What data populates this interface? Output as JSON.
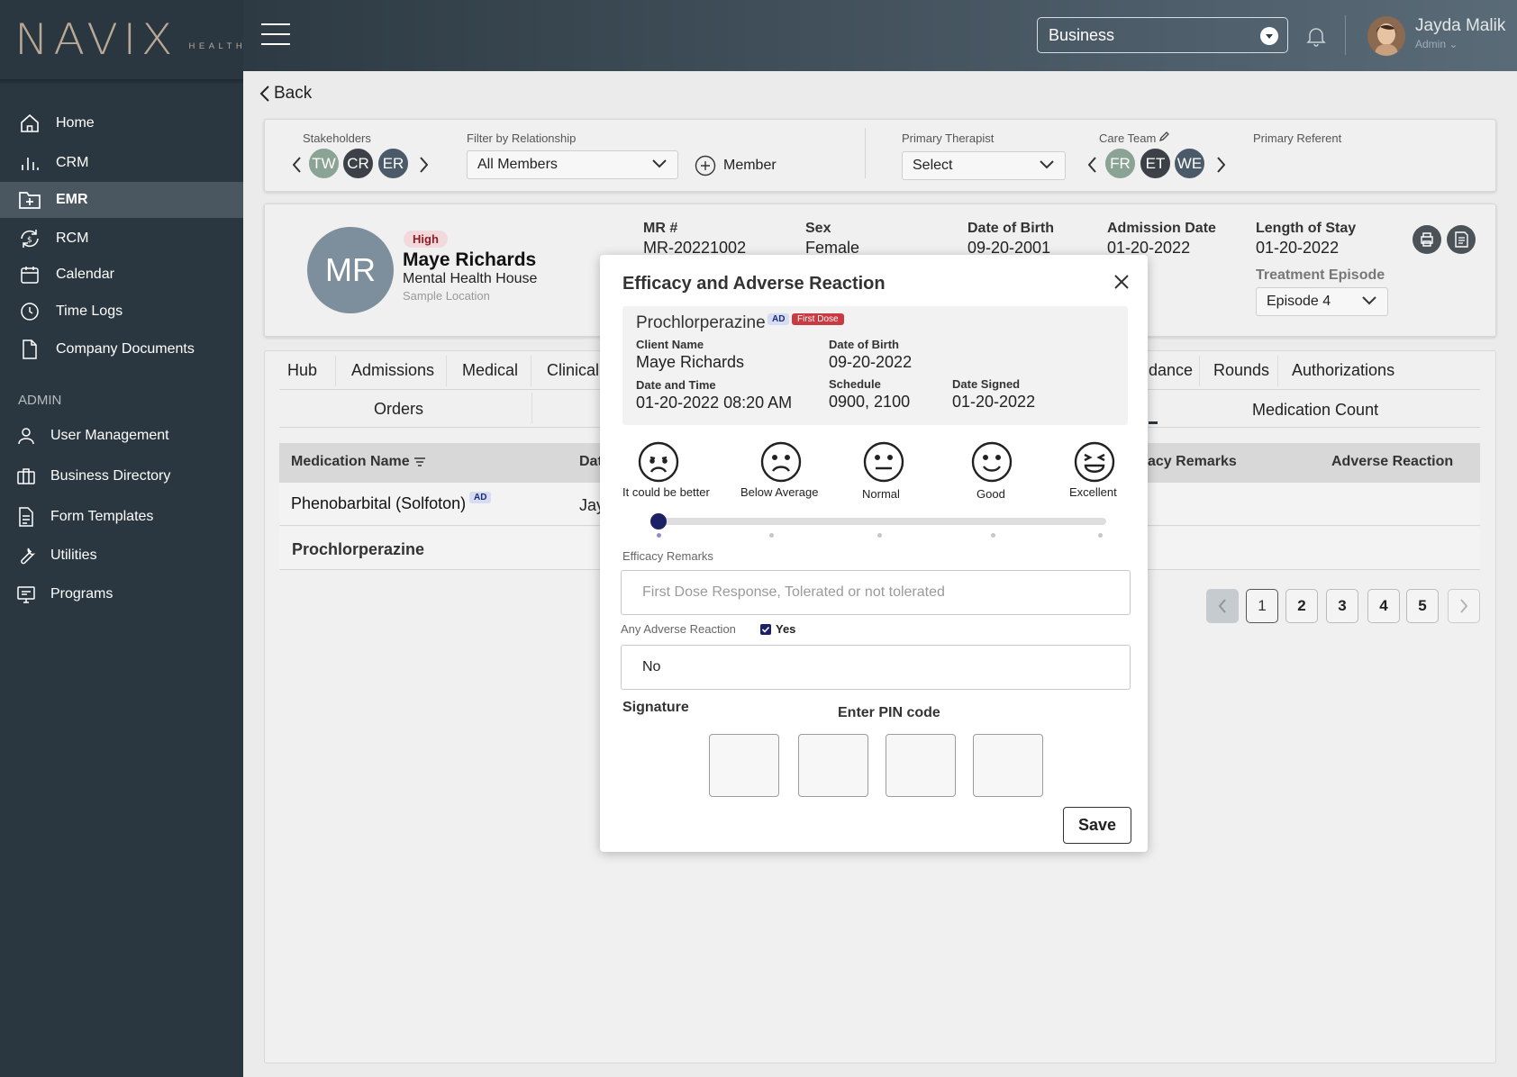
{
  "brand": {
    "name": "NAVIX",
    "sub": "HEALTH"
  },
  "sidebar": {
    "items": [
      {
        "label": "Home",
        "icon": "home-icon"
      },
      {
        "label": "CRM",
        "icon": "bar-chart-icon"
      },
      {
        "label": "EMR",
        "icon": "folder-plus-icon"
      },
      {
        "label": "RCM",
        "icon": "money-cycle-icon"
      },
      {
        "label": "Calendar",
        "icon": "calendar-icon"
      },
      {
        "label": "Time Logs",
        "icon": "clock-icon"
      },
      {
        "label": "Company Documents",
        "icon": "document-icon"
      }
    ],
    "admin_heading": "ADMIN",
    "admin_items": [
      {
        "label": "User Management",
        "icon": "user-icon"
      },
      {
        "label": "Business Directory",
        "icon": "briefcase-icon"
      },
      {
        "label": "Form Templates",
        "icon": "form-icon"
      },
      {
        "label": "Utilities",
        "icon": "wrench-icon"
      },
      {
        "label": "Programs",
        "icon": "monitor-icon"
      }
    ],
    "active": "EMR"
  },
  "topbar": {
    "business_select": "Business",
    "user_name": "Jayda Malik",
    "user_role": "Admin"
  },
  "back_label": "Back",
  "filter_bar": {
    "stakeholders_label": "Stakeholders",
    "stakeholders": [
      "TW",
      "CR",
      "ER"
    ],
    "relationship_label": "Filter by Relationship",
    "relationship_value": "All Members",
    "member_button": "Member",
    "therapist_label": "Primary Therapist",
    "therapist_value": "Select",
    "care_team_label": "Care Team",
    "care_team": [
      "FR",
      "ET",
      "WE"
    ],
    "referent_label": "Primary Referent"
  },
  "patient": {
    "initials": "MR",
    "risk": "High",
    "name": "Maye Richards",
    "facility": "Mental Health House",
    "location": "Sample Location",
    "mr_label": "MR #",
    "mr_value": "MR-20221002",
    "sex_label": "Sex",
    "sex_value": "Female",
    "dob_label": "Date of Birth",
    "dob_value": "09-20-2001",
    "admission_label": "Admission Date",
    "admission_value": "01-20-2022",
    "los_label": "Length of Stay",
    "los_value": "01-20-2022",
    "episode_label": "Treatment Episode",
    "episode_value": "Episode 4"
  },
  "tabs": [
    "Hub",
    "Admissions",
    "Medical",
    "Clinical",
    "dance",
    "Rounds",
    "Authorizations"
  ],
  "subtabs": {
    "left": "Orders",
    "right": "Medication Count"
  },
  "table": {
    "headers": {
      "name": "Medication Name",
      "date": "Dat",
      "remarks": "acy Remarks",
      "adverse": "Adverse Reaction"
    },
    "rows": [
      {
        "name": "Phenobarbital (Solfoton)",
        "tag": "AD",
        "col2": "Jay"
      },
      {
        "name": "Prochlorperazine"
      }
    ]
  },
  "pagination": {
    "pages": [
      "1",
      "2",
      "3",
      "4",
      "5"
    ],
    "current": "1"
  },
  "modal": {
    "title": "Efficacy and Adverse Reaction",
    "drug": "Prochlorperazine",
    "tag_ad": "AD",
    "tag_first_dose": "First Dose",
    "client_name_label": "Client Name",
    "client_name": "Maye Richards",
    "dob_label": "Date of Birth",
    "dob": "09-20-2022",
    "datetime_label": "Date and Time",
    "datetime": "01-20-2022 08:20 AM",
    "schedule_label": "Schedule",
    "schedule": "0900, 2100",
    "date_signed_label": "Date Signed",
    "date_signed": "01-20-2022",
    "ratings": [
      {
        "label": "It could be better",
        "icon": "worried-face-icon"
      },
      {
        "label": "Below Average",
        "icon": "sad-face-icon"
      },
      {
        "label": "Normal",
        "icon": "neutral-face-icon"
      },
      {
        "label": "Good",
        "icon": "smile-face-icon"
      },
      {
        "label": "Excellent",
        "icon": "laughing-face-icon"
      }
    ],
    "rating_selected_index": 0,
    "efficacy_label": "Efficacy Remarks",
    "efficacy_placeholder": "First Dose Response, Tolerated or not tolerated",
    "adverse_label": "Any Adverse Reaction",
    "adverse_check_label": "Yes",
    "adverse_checked": true,
    "adverse_value": "No",
    "signature_label": "Signature",
    "pin_label": "Enter PIN code",
    "save_label": "Save"
  },
  "colors": {
    "sidebar": "#2a3740",
    "accent": "#1c2064",
    "risk_high": "#8a1f28",
    "first_dose": "#c93a42"
  }
}
